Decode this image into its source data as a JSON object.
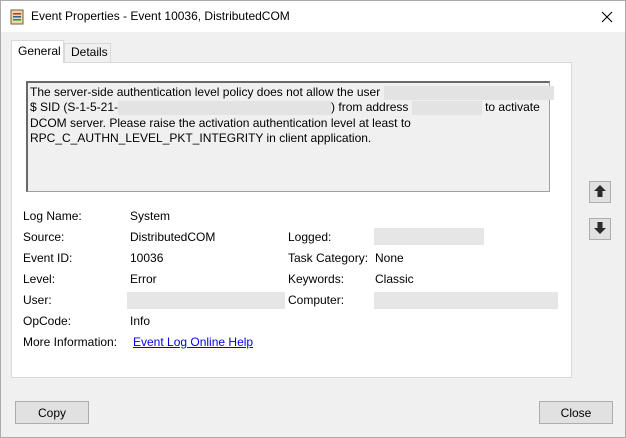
{
  "window": {
    "title": "Event Properties - Event 10036, DistributedCOM",
    "close_glyph": "✕"
  },
  "tabs": [
    {
      "label": "General",
      "active": true
    },
    {
      "label": "Details",
      "active": false
    }
  ],
  "description": {
    "line1": "The server-side authentication level policy does not allow the user",
    "line2_a": "$ SID (S-1-5-21-",
    "line2_b": ") from address",
    "line2_c": "to activate",
    "line3": "DCOM server. Please raise the activation authentication level at least to",
    "line4": "RPC_C_AUTHN_LEVEL_PKT_INTEGRITY in client application."
  },
  "fields": {
    "log_name": {
      "label": "Log Name:",
      "value": "System"
    },
    "source": {
      "label": "Source:",
      "value": "DistributedCOM"
    },
    "logged": {
      "label": "Logged:",
      "value": ""
    },
    "event_id": {
      "label": "Event ID:",
      "value": "10036"
    },
    "task_category": {
      "label": "Task Category:",
      "value": "None"
    },
    "level": {
      "label": "Level:",
      "value": "Error"
    },
    "keywords": {
      "label": "Keywords:",
      "value": "Classic"
    },
    "user": {
      "label": "User:",
      "value": ""
    },
    "computer": {
      "label": "Computer:",
      "value": ""
    },
    "opcode": {
      "label": "OpCode:",
      "value": "Info"
    },
    "more_info": {
      "label": "More Information:",
      "link": "Event Log Online Help"
    }
  },
  "buttons": {
    "copy": "Copy",
    "close": "Close"
  },
  "icons": {
    "app": "event-viewer-icon",
    "up": "arrow-up-icon",
    "down": "arrow-down-icon"
  },
  "colors": {
    "link": "#0000ee",
    "redaction": "#e6e6e6"
  }
}
